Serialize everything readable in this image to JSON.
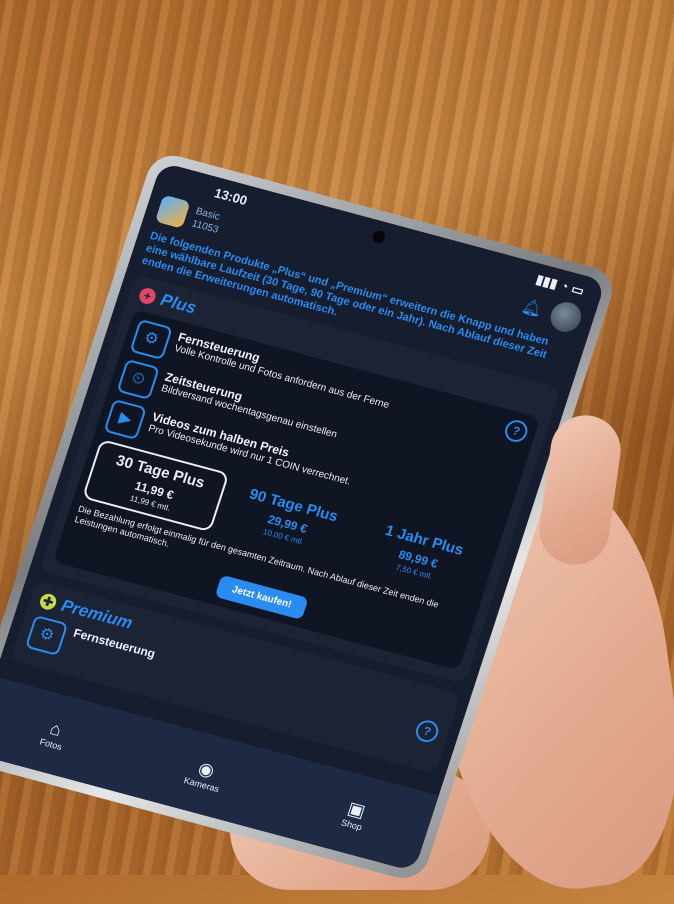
{
  "status": {
    "time": "13:00",
    "signal": "▮▮▮ ◔ ▭"
  },
  "account": {
    "plan": "Basic",
    "coins": "11053"
  },
  "intro": "Die folgenden Produkte „Plus“ und „Premium“ erweitern die Knapp und haben eine wählbare Laufzeit (30 Tage, 90 Tage oder ein Jahr). Nach Ablauf dieser Zeit enden die Erweiterungen automatisch.",
  "plus": {
    "title": "Plus",
    "features": [
      {
        "icon": "remote-control-icon",
        "name": "Fernsteuerung",
        "desc": "Volle Kontrolle und Fotos anfordern aus der Ferne"
      },
      {
        "icon": "schedule-icon",
        "name": "Zeitsteuerung",
        "desc": "Bildversand wochentagsgenau einstellen"
      },
      {
        "icon": "video-discount-icon",
        "name": "Videos zum halben Preis",
        "desc": "Pro Videosekunde wird nur 1 COIN verrechnet."
      }
    ],
    "plans": [
      {
        "name": "30 Tage Plus",
        "price": "11,99 €",
        "monthly": "11,99 € mtl."
      },
      {
        "name": "90 Tage Plus",
        "price": "29,99 €",
        "monthly": "10,00 € mtl."
      },
      {
        "name": "1 Jahr Plus",
        "price": "89,99 €",
        "monthly": "7,50 € mtl."
      }
    ],
    "note": "Die Bezahlung erfolgt einmalig für den gesamten Zeitraum. Nach Ablauf dieser Zeit enden die Leistungen automatisch.",
    "buy_label": "Jetzt kaufen!"
  },
  "premium": {
    "title": "Premium",
    "feature": "Fernsteuerung"
  },
  "tabs": [
    {
      "label": "Fotos"
    },
    {
      "label": "Kameras"
    },
    {
      "label": "Shop"
    }
  ],
  "colors": {
    "accent": "#2a8cf0",
    "background": "#151d2e",
    "plus": "#e0466a",
    "premium": "#c8d84a"
  }
}
